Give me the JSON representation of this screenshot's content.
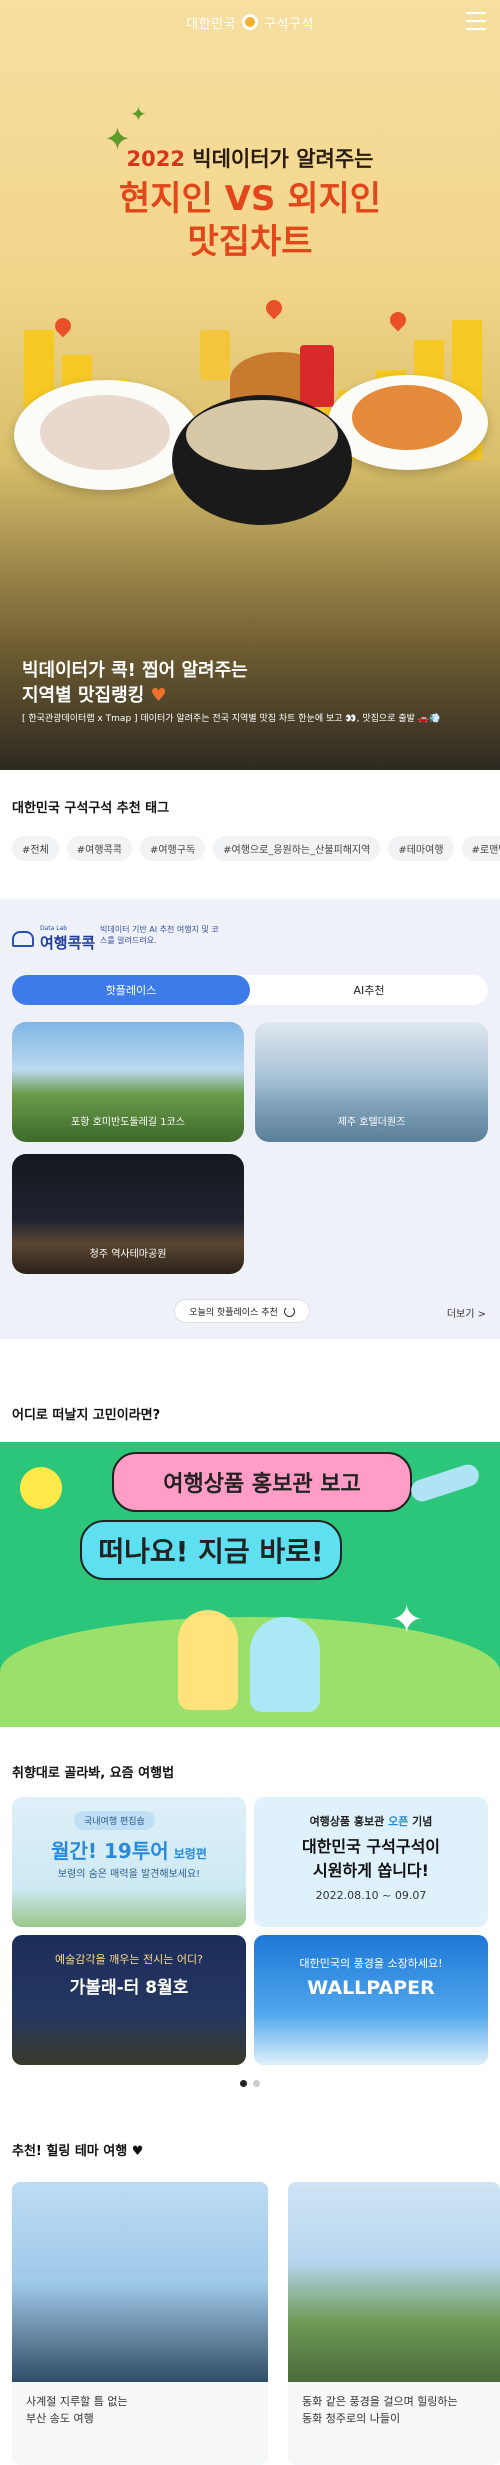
{
  "header": {
    "logo_text_1": "대한민국",
    "logo_text_2": "구석구석"
  },
  "hero": {
    "subtitle_year": "2022",
    "subtitle_rest": "빅데이터가 알려주는",
    "title_line1": "현지인 VS 외지인",
    "title_line2": "맛집차트",
    "caption_line1": "빅데이터가 콕! 찝어 알려주는",
    "caption_line2": "지역별 맛집랭킹",
    "description": "[ 한국관광데이터랩 x Tmap ] 데이터가 알려주는 전국 지역별 맛집 차트 한눈에 보고 👀, 맛집으로 출발 🚗💨",
    "colors": {
      "title": "#e2461b",
      "year": "#d8361c",
      "bar": "#f6c824"
    }
  },
  "tags_section": {
    "title": "대한민국 구석구석 추천 태그",
    "tags": [
      "#전체",
      "#여행콕콕",
      "#여행구독",
      "#여행으로_응원하는_산불피해지역",
      "#테마여행",
      "#로맨틱_야"
    ]
  },
  "travel_kokkok": {
    "logo_small": "Data Lab",
    "logo_name": "여행콕콕",
    "description": "빅데이터 기반 AI 추천 여행지 및 코스를 알려드려요.",
    "toggle": [
      "핫플레이스",
      "AI추천"
    ],
    "cards": [
      {
        "label": "포항 호미반도둘레길 1코스"
      },
      {
        "label": "제주 호텔더원즈"
      },
      {
        "label": "청주 역사테마공원"
      }
    ],
    "today_button": "오늘의 핫플레이스 추천",
    "more": "더보기 >"
  },
  "where_section": {
    "title": "어디로 떠날지 고민이라면?",
    "banner_line1": "여행상품 홍보관 보고",
    "banner_line2": "떠나요! 지금 바로!"
  },
  "products_section": {
    "title": "취향대로 골라봐, 요즘 여행법",
    "cards": [
      {
        "badge": "국내여행 편집숍",
        "title": "월간! 19투어",
        "title_suffix": "보령편",
        "subtitle": "보령의 숨은 매력을 발견해보세요!"
      },
      {
        "line1a": "여행상품 홍보관",
        "line1b": "오픈",
        "line1c": "기념",
        "line2": "대한민국 구석구석이",
        "line3": "시원하게 쏩니다!",
        "date": "2022.08.10 ~ 09.07"
      },
      {
        "line1": "예술감각을 깨우는 전시는 어디?",
        "line2": "가볼래-터 8월호"
      },
      {
        "line1": "대한민국의 풍경을 소장하세요!",
        "line2": "WALLPAPER"
      }
    ]
  },
  "healing_section": {
    "title": "추천! 힐링 테마 여행 ♥",
    "cards": [
      {
        "line1": "사계절 지루할 틈 없는",
        "line2": "부산 송도 여행"
      },
      {
        "line1": "동화 같은 풍경을 걸으며 힐링하는",
        "line2": "동화 청주로의 나들이"
      }
    ]
  }
}
